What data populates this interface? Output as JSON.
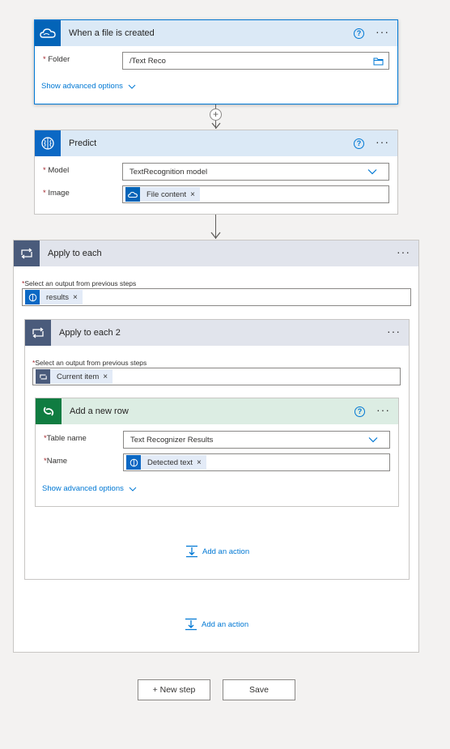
{
  "trigger": {
    "title": "When a file is created",
    "folder_label": "Folder",
    "folder_value": "/Text Reco",
    "advanced_link": "Show advanced options"
  },
  "predict": {
    "title": "Predict",
    "model_label": "Model",
    "model_value": "TextRecognition model",
    "image_label": "Image",
    "image_token": "File content"
  },
  "apply1": {
    "title": "Apply to each",
    "select_label": "Select an output from previous steps",
    "token": "results"
  },
  "apply2": {
    "title": "Apply to each 2",
    "select_label": "Select an output from previous steps",
    "token": "Current item"
  },
  "addrow": {
    "title": "Add a new row",
    "table_label": "Table name",
    "table_value": "Text Recognizer Results",
    "name_label": "Name",
    "name_token": "Detected text",
    "advanced_link": "Show advanced options"
  },
  "add_action_inner": "Add an action",
  "add_action_outer": "Add an action",
  "buttons": {
    "new_step": "+ New step",
    "save": "Save"
  },
  "colors": {
    "accent": "#0078d4",
    "trigger_header": "#dbe9f6",
    "loop_header": "#e1e4ec",
    "dataverse_header": "#dcede3",
    "dataverse_icon": "#107c41",
    "loop_icon": "#4a5b7b"
  }
}
